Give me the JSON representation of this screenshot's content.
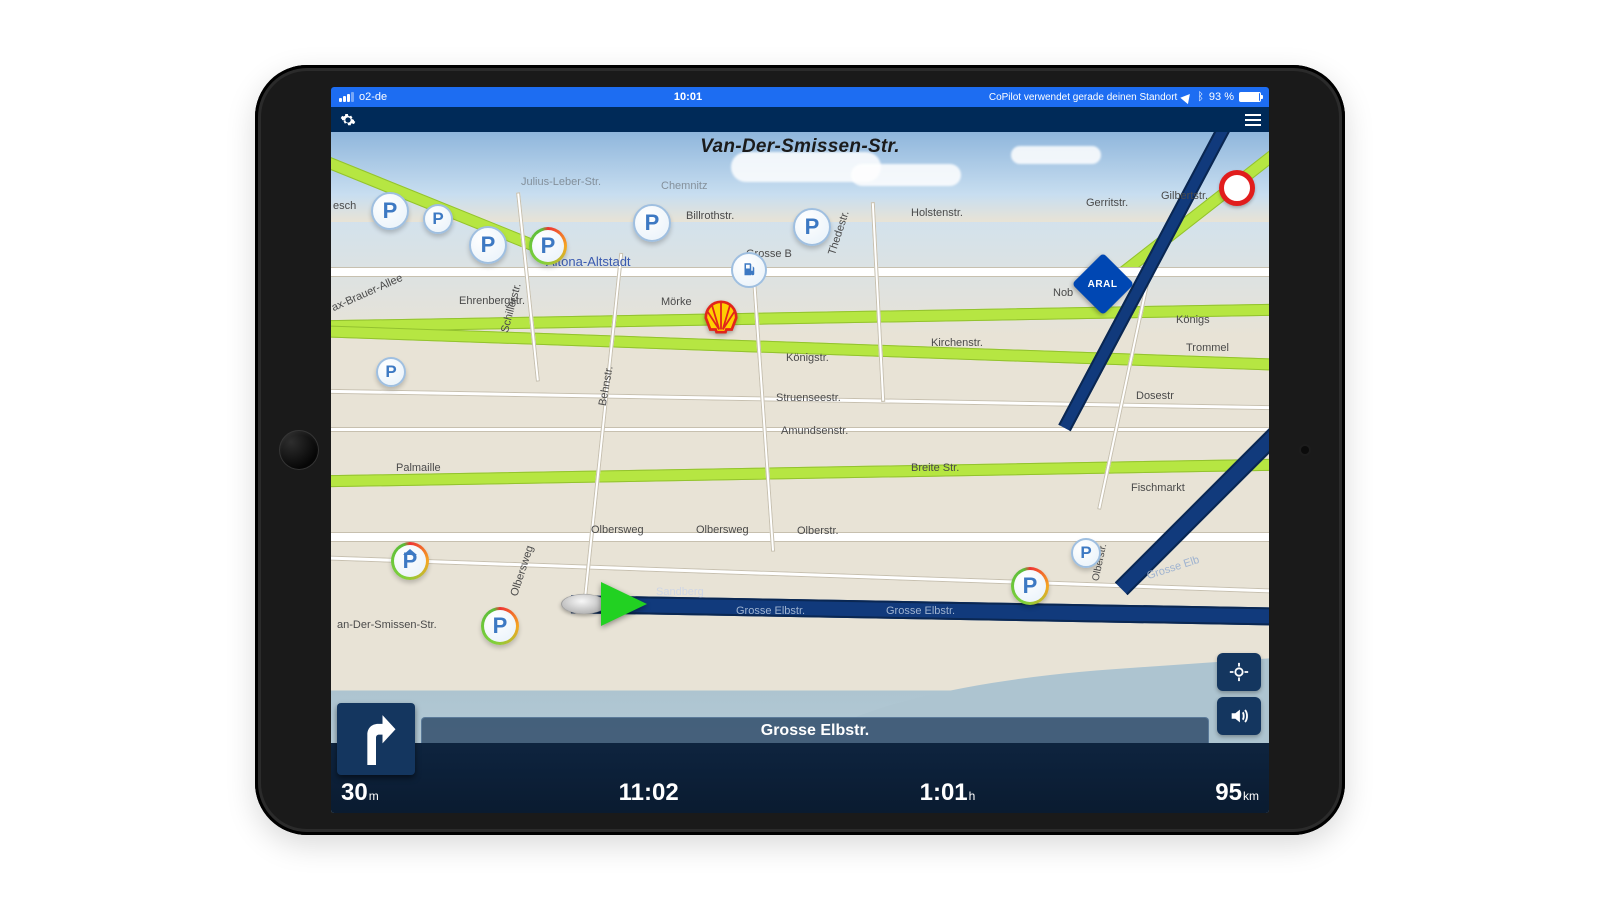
{
  "status_bar": {
    "carrier": "o2-de",
    "time": "10:01",
    "location_text": "CoPilot verwendet gerade deinen Standort",
    "battery_pct": "93 %"
  },
  "top_street": "Van-Der-Smissen-Str.",
  "current_street": "Grosse Elbstr.",
  "district": "Altona-Altstadt",
  "streets": {
    "ehrenbergstr": "Ehrenbergstr.",
    "morke": "Mörke",
    "konigstr": "Königstr.",
    "konigs2": "Königs",
    "kirchenstr": "Kirchenstr.",
    "grosseb": "Grosse B",
    "billrothstr": "Billrothstr.",
    "thedestr": "Thedestr.",
    "schillerstr": "Schillerstr.",
    "behnstr": "Behnstr.",
    "struensee": "Struenseestr.",
    "amundsen": "Amundsenstr.",
    "palmaille": "Palmaille",
    "breitestr": "Breite Str.",
    "olbersweg": "Olbersweg",
    "olbersweg2": "Olbersweg",
    "olberstr": "Olberstr.",
    "olbersweg3": "Olbersweg",
    "sandberg": "Sandberg",
    "grosse_elb": "Grosse Elbstr.",
    "grosse_elb2": "Grosse Elbstr.",
    "grosse_elb3": "Grosse Elb",
    "vds": "an-Der-Smissen-Str.",
    "fischmarkt": "Fischmarkt",
    "dosestr": "Dosestr",
    "trommel": "Trommel",
    "nob": "Nob",
    "holstenstr": "Holstenstr.",
    "gerritstr": "Gerritstr.",
    "gilbertstr": "Gilbertstr.",
    "chemnitz": "Chemnitz",
    "juliusleber": "Julius-Leber-Str.",
    "maxbrauer": "ax-Brauer-Allee",
    "esch": "esch"
  },
  "brands": {
    "aral": "ARAL"
  },
  "metrics": {
    "dist_turn_v": "30",
    "dist_turn_u": "m",
    "eta_v": "11:02",
    "eta_u": "",
    "remain_v": "1:01",
    "remain_u": "h",
    "total_v": "95",
    "total_u": "km"
  }
}
